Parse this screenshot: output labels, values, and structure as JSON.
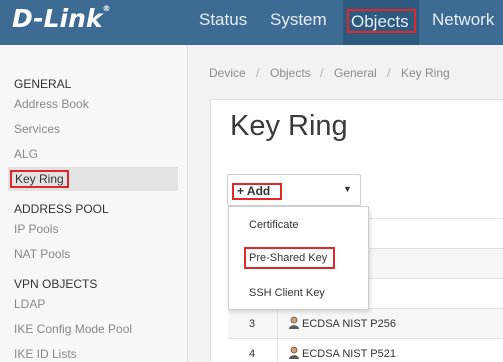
{
  "header": {
    "logo": "D-Link",
    "logo_mark": "®",
    "nav": [
      "Status",
      "System",
      "Objects",
      "Network"
    ]
  },
  "sidebar": {
    "sections": [
      {
        "title": "GENERAL",
        "items": [
          "Address Book",
          "Services",
          "ALG",
          "Key Ring"
        ]
      },
      {
        "title": "ADDRESS POOL",
        "items": [
          "IP Pools",
          "NAT Pools"
        ]
      },
      {
        "title": "VPN OBJECTS",
        "items": [
          "LDAP",
          "IKE Config Mode Pool",
          "IKE ID Lists"
        ]
      }
    ],
    "active_item": "Key Ring"
  },
  "breadcrumb": [
    "Device",
    "Objects",
    "General",
    "Key Ring"
  ],
  "page_title": "Key Ring",
  "add_button": {
    "label": "Add"
  },
  "dropdown": {
    "options": [
      "Certificate",
      "Pre-Shared Key",
      "SSH Client Key"
    ],
    "highlighted": "Pre-Shared Key"
  },
  "table": {
    "rows": [
      {
        "index": "3",
        "name": "ECDSA NIST P256"
      },
      {
        "index": "4",
        "name": "ECDSA NIST P521"
      }
    ]
  },
  "colors": {
    "topbar": "#3d6b93",
    "highlight_box": "#e02828"
  }
}
